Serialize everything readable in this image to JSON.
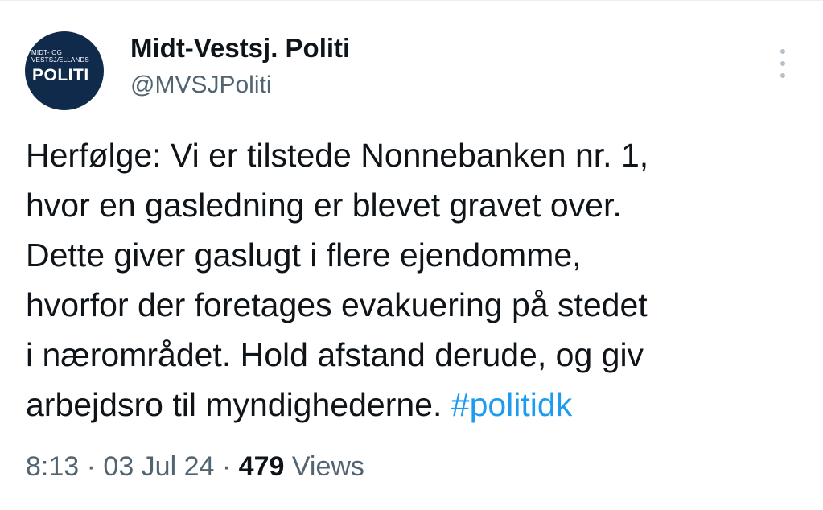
{
  "account": {
    "avatar_small_text": "MIDT- OG VESTSJÆLLANDS",
    "avatar_big_text": "POLITI",
    "display_name": "Midt-Vestsj. Politi",
    "handle": "@MVSJPoliti"
  },
  "tweet": {
    "lines": [
      "Herfølge: Vi er tilstede Nonnebanken nr. 1,",
      "hvor en gasledning er blevet gravet over.",
      "Dette giver gaslugt i flere ejendomme,",
      "hvorfor der foretages evakuering på stedet",
      "i nærområdet. Hold afstand derude, og giv",
      "arbejdsro til myndighederne."
    ],
    "hashtag": "#politidk"
  },
  "meta": {
    "time": "8:13",
    "separator": "·",
    "date": "03 Jul 24",
    "views_count": "479",
    "views_label": "Views"
  },
  "colors": {
    "text": "#0f1419",
    "secondary": "#536471",
    "link": "#1d9bf0",
    "avatar_bg": "#0f2a4a"
  },
  "icons": {
    "more": "more-vertical-icon"
  }
}
